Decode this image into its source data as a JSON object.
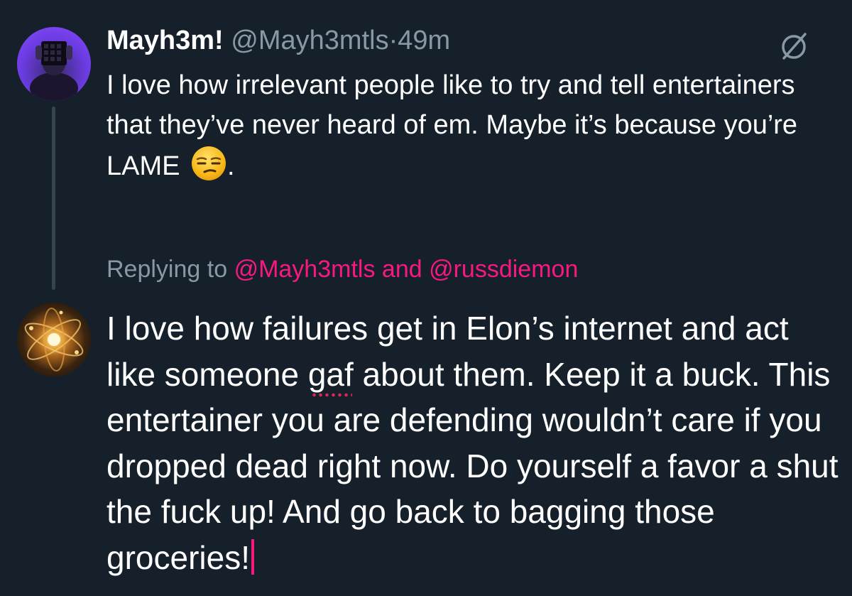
{
  "original_tweet": {
    "display_name": "Mayh3m!",
    "handle": "@Mayh3mtls",
    "separator": "·",
    "time_ago": "49m",
    "text": "I love how irrelevant people like to try and tell entertainers that they’ve never heard of em. Maybe it’s because you’re LAME",
    "text_end": ".",
    "emoji": "unamused-face-icon",
    "action_icon": "no-entry-icon"
  },
  "reply": {
    "replying_prefix": "Replying to",
    "mention_1": "@Mayh3mtls",
    "conjunction": "and",
    "mention_2": "@russdiemon",
    "text_before": "I love how failures get in Elon’s internet and act like someone ",
    "misspelled_word": "gaf",
    "text_after": " about them. Keep it a buck. This entertainer you are defending wouldn’t care if you dropped dead right now. Do yourself a favor a shut the fuck up! And go back to bagging those groceries!"
  },
  "colors": {
    "background": "#15202b",
    "text": "#ffffff",
    "secondary_text": "#8899a6",
    "accent": "#f91880",
    "thread_line": "#38444d"
  }
}
